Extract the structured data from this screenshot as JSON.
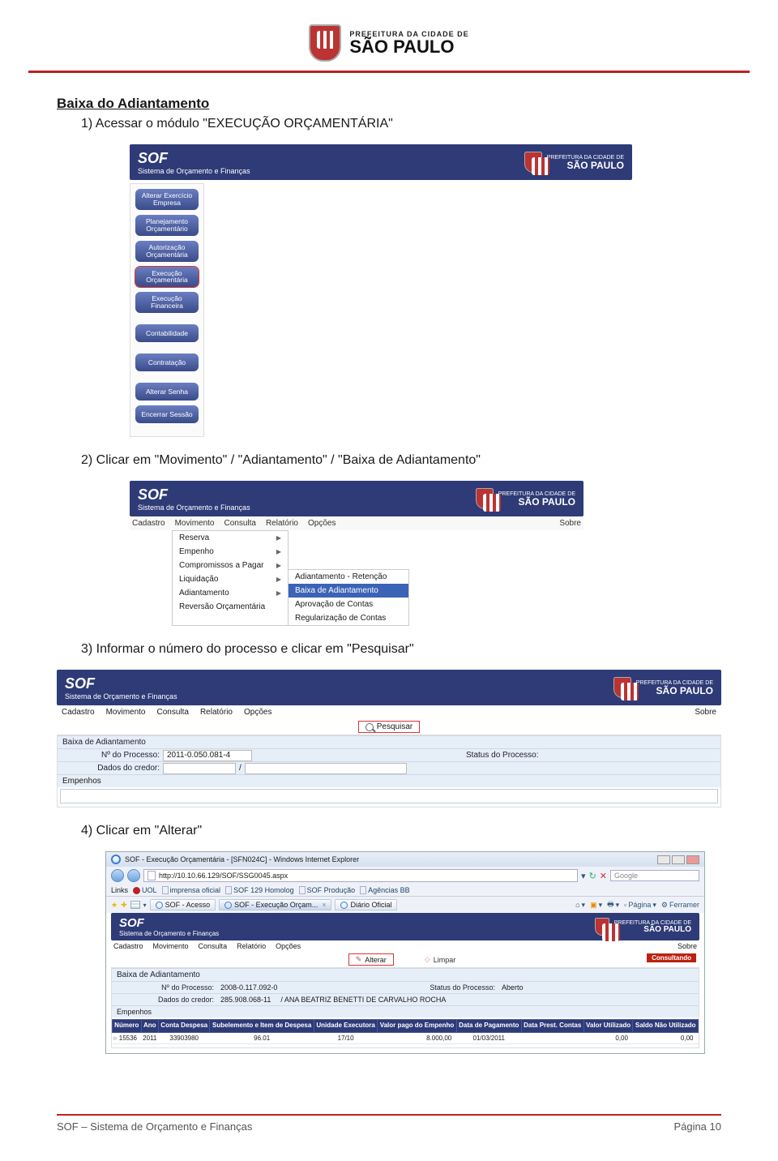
{
  "brand": {
    "small": "PREFEITURA DA CIDADE DE",
    "big": "SÃO PAULO"
  },
  "section_title": "Baixa do Adiantamento",
  "steps": {
    "s1": "1)  Acessar o módulo \"EXECUÇÃO ORÇAMENTÁRIA\"",
    "s2": "2)  Clicar em \"Movimento\" / \"Adiantamento\" / \"Baixa de Adiantamento\"",
    "s3": "3)  Informar o número do processo e clicar em \"Pesquisar\"",
    "s4": "4)  Clicar em \"Alterar\""
  },
  "sof": {
    "title": "SOF",
    "sub": "Sistema de Orçamento e Finanças"
  },
  "scr1": {
    "buttons": [
      "Alterar Exercício Empresa",
      "Planejamento Orçamentário",
      "Autorização Orçamentária",
      "Execução Orçamentária",
      "Execução Financeira",
      "Contabilidade",
      "Contratação",
      "Alterar Senha",
      "Encerrar Sessão"
    ]
  },
  "menubar_items": [
    "Cadastro",
    "Movimento",
    "Consulta",
    "Relatório",
    "Opções"
  ],
  "menubar_right": "Sobre",
  "scr2": {
    "drop1": [
      "Reserva",
      "Empenho",
      "Compromissos a Pagar",
      "Liquidação",
      "Adiantamento",
      "Reversão Orçamentária"
    ],
    "drop2": [
      "Adiantamento - Retenção",
      "Baixa de Adiantamento",
      "Aprovação de Contas",
      "Regularização de Contas"
    ]
  },
  "scr3": {
    "pesquisar": "Pesquisar",
    "form_title": "Baixa de Adiantamento",
    "lab_nproc": "Nº do Processo:",
    "val_nproc": "2011-0.050.081-4",
    "lab_status": "Status do Processo:",
    "lab_credor": "Dados do credor:",
    "credor_sep": "/",
    "empenhos": "Empenhos"
  },
  "scr4": {
    "ie_title": "SOF - Execução Orçamentária - [SFN024C] - Windows Internet Explorer",
    "ie_url": "http://10.10.66.129/SOF/SSG0045.aspx",
    "ie_search": "Google",
    "links_label": "Links",
    "links": [
      "UOL",
      "imprensa oficial",
      "SOF 129 Homolog",
      "SOF Produção",
      "Agências BB"
    ],
    "tab1": "SOF - Acesso",
    "tab2": "SOF - Execução Orçam...",
    "tab3": "Diário Oficial",
    "ctrl_pagina": "Página",
    "ctrl_ferram": "Ferramer",
    "alterar": "Alterar",
    "limpar": "Limpar",
    "consultando": "Consultando",
    "form_title": "Baixa de Adiantamento",
    "lab_nproc": "Nº do Processo:",
    "val_nproc": "2008-0.117.092-0",
    "lab_status": "Status do Processo:",
    "val_status": "Aberto",
    "lab_credor": "Dados do credor:",
    "val_credor_num": "285.908.068-11",
    "val_credor_nome": "/ ANA BEATRIZ BENETTI DE CARVALHO ROCHA",
    "empenhos": "Empenhos",
    "table": {
      "headers": [
        "Número",
        "Ano",
        "Conta Despesa",
        "Subelemento e Item de Despesa",
        "Unidade Executora",
        "Valor pago do Empenho",
        "Data de Pagamento",
        "Data Prest. Contas",
        "Valor Utilizado",
        "Saldo Não Utilizado"
      ],
      "row": [
        "15536",
        "2011",
        "33903980",
        "96.01",
        "17/10",
        "8.000,00",
        "01/03/2011",
        "",
        "0,00",
        "0,00"
      ]
    }
  },
  "footer": {
    "left": "SOF – Sistema de Orçamento e Finanças",
    "right": "Página 10"
  }
}
